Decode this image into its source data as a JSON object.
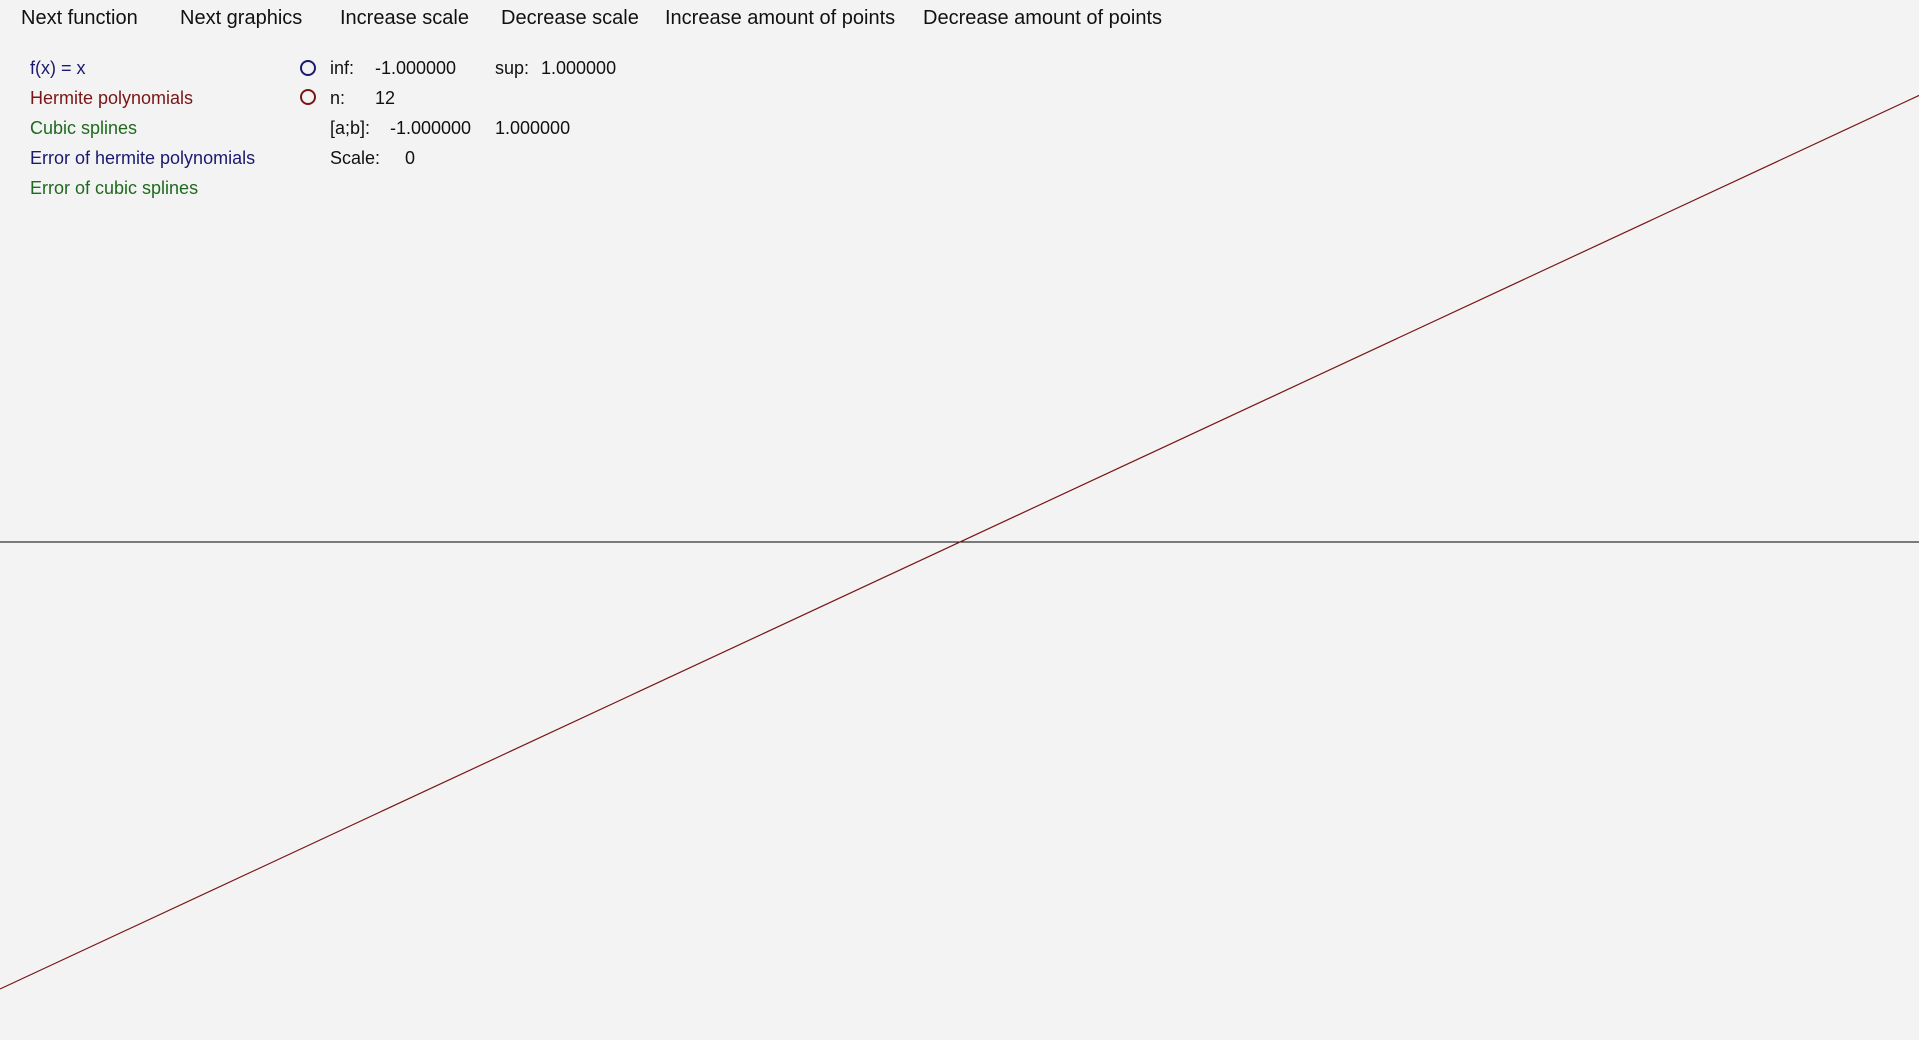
{
  "menu": {
    "next_function": "Next function",
    "next_graphics": "Next graphics",
    "increase_scale": "Increase scale",
    "decrease_scale": "Decrease scale",
    "increase_points": "Increase amount of points",
    "decrease_points": "Decrease amount of points"
  },
  "legend": {
    "function": {
      "label": "f(x) = x",
      "color": "#1a1a70"
    },
    "hermite": {
      "label": "Hermite polynomials",
      "color": "#7a1616"
    },
    "splines": {
      "label": "Cubic splines",
      "color": "#1f6a1f"
    },
    "hermite_error": {
      "label": "Error of hermite polynomials",
      "color": "#1a1a70"
    },
    "splines_error": {
      "label": "Error of cubic splines",
      "color": "#1f6a1f"
    }
  },
  "info": {
    "inf_label": "inf:",
    "inf_value": "-1.000000",
    "sup_label": "sup:",
    "sup_value": "1.000000",
    "n_label": "n:",
    "n_value": "12",
    "ab_label": "[a;b]:",
    "a_value": "-1.000000",
    "b_value": "1.000000",
    "scale_label": "Scale:",
    "scale_value": "0"
  },
  "radios": {
    "radio_1_color": "#1a1a70",
    "radio_2_color": "#7a1616"
  },
  "chart_data": {
    "type": "line",
    "series": [
      {
        "color": "#7a1616",
        "x": [
          -1,
          1
        ],
        "y": [
          -1,
          1
        ]
      }
    ],
    "axis_color": "#000000"
  }
}
